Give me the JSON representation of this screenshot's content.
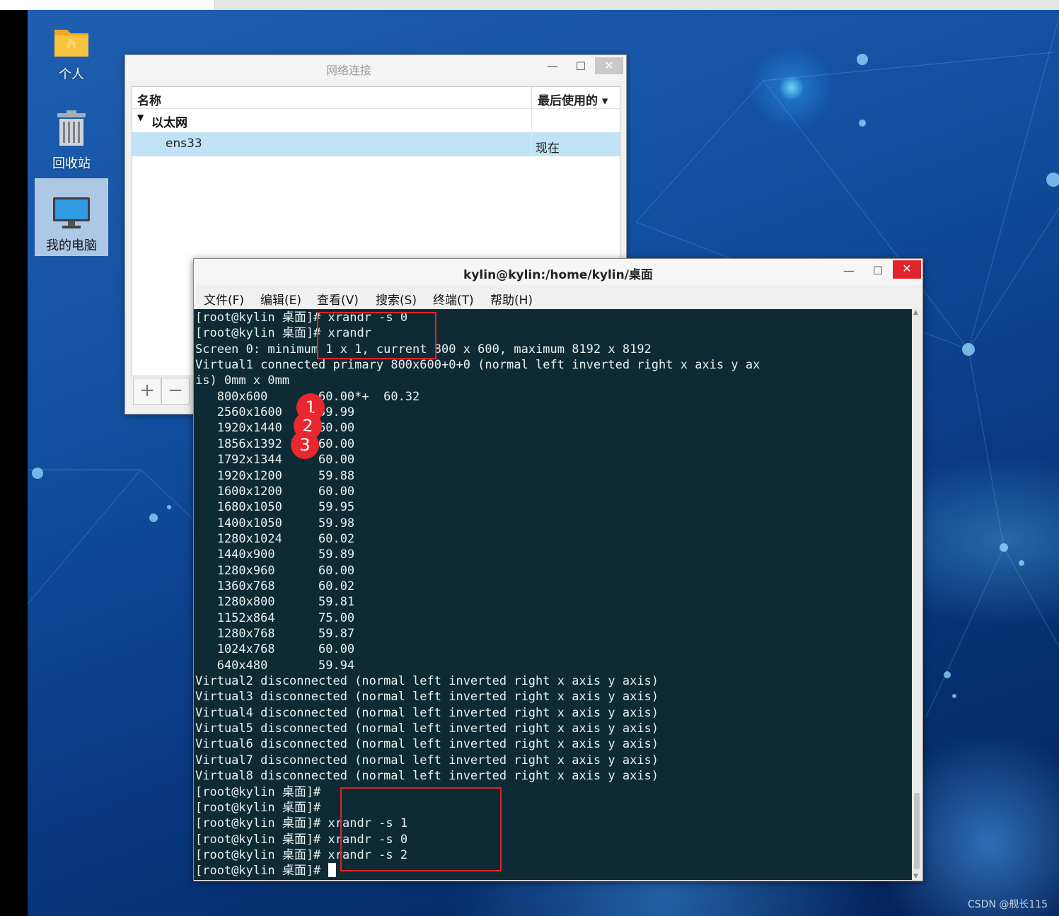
{
  "desktop": {
    "icons": [
      {
        "label": "个人",
        "icon": "folder-home-icon"
      },
      {
        "label": "回收站",
        "icon": "trash-icon"
      },
      {
        "label": "我的电脑",
        "icon": "computer-icon"
      }
    ],
    "watermark": "CSDN @舰长115"
  },
  "network_window": {
    "title": "网络连接",
    "columns": {
      "name": "名称",
      "last_used": "最后使用的 ▾"
    },
    "group": "以太网",
    "connection": {
      "name": "ens33",
      "last_used": "现在"
    },
    "add_label": "+",
    "remove_label": "−",
    "controls": {
      "minimize": "—",
      "maximize": "☐",
      "close": "✕"
    }
  },
  "terminal": {
    "title": "kylin@kylin:/home/kylin/桌面",
    "menu": [
      "文件(F)",
      "编辑(E)",
      "查看(V)",
      "搜索(S)",
      "终端(T)",
      "帮助(H)"
    ],
    "controls": {
      "minimize": "—",
      "maximize": "☐",
      "close": "✕"
    },
    "lines": [
      "[root@kylin 桌面]# xrandr -s 0",
      "[root@kylin 桌面]# xrandr",
      "Screen 0: minimum 1 x 1, current 800 x 600, maximum 8192 x 8192",
      "Virtual1 connected primary 800x600+0+0 (normal left inverted right x axis y ax",
      "is) 0mm x 0mm",
      "   800x600       60.00*+  60.32",
      "   2560x1600     59.99",
      "   1920x1440     60.00",
      "   1856x1392     60.00",
      "   1792x1344     60.00",
      "   1920x1200     59.88",
      "   1600x1200     60.00",
      "   1680x1050     59.95",
      "   1400x1050     59.98",
      "   1280x1024     60.02",
      "   1440x900      59.89",
      "   1280x960      60.00",
      "   1360x768      60.02",
      "   1280x800      59.81",
      "   1152x864      75.00",
      "   1280x768      59.87",
      "   1024x768      60.00",
      "   640x480       59.94",
      "Virtual2 disconnected (normal left inverted right x axis y axis)",
      "Virtual3 disconnected (normal left inverted right x axis y axis)",
      "Virtual4 disconnected (normal left inverted right x axis y axis)",
      "Virtual5 disconnected (normal left inverted right x axis y axis)",
      "Virtual6 disconnected (normal left inverted right x axis y axis)",
      "Virtual7 disconnected (normal left inverted right x axis y axis)",
      "Virtual8 disconnected (normal left inverted right x axis y axis)",
      "[root@kylin 桌面]#",
      "[root@kylin 桌面]#",
      "[root@kylin 桌面]# xrandr -s 1",
      "[root@kylin 桌面]# xrandr -s 0",
      "[root@kylin 桌面]# xrandr -s 2",
      "[root@kylin 桌面]# "
    ]
  },
  "annotations": {
    "badges": [
      "1",
      "2",
      "3"
    ],
    "color": "#e8282e"
  }
}
